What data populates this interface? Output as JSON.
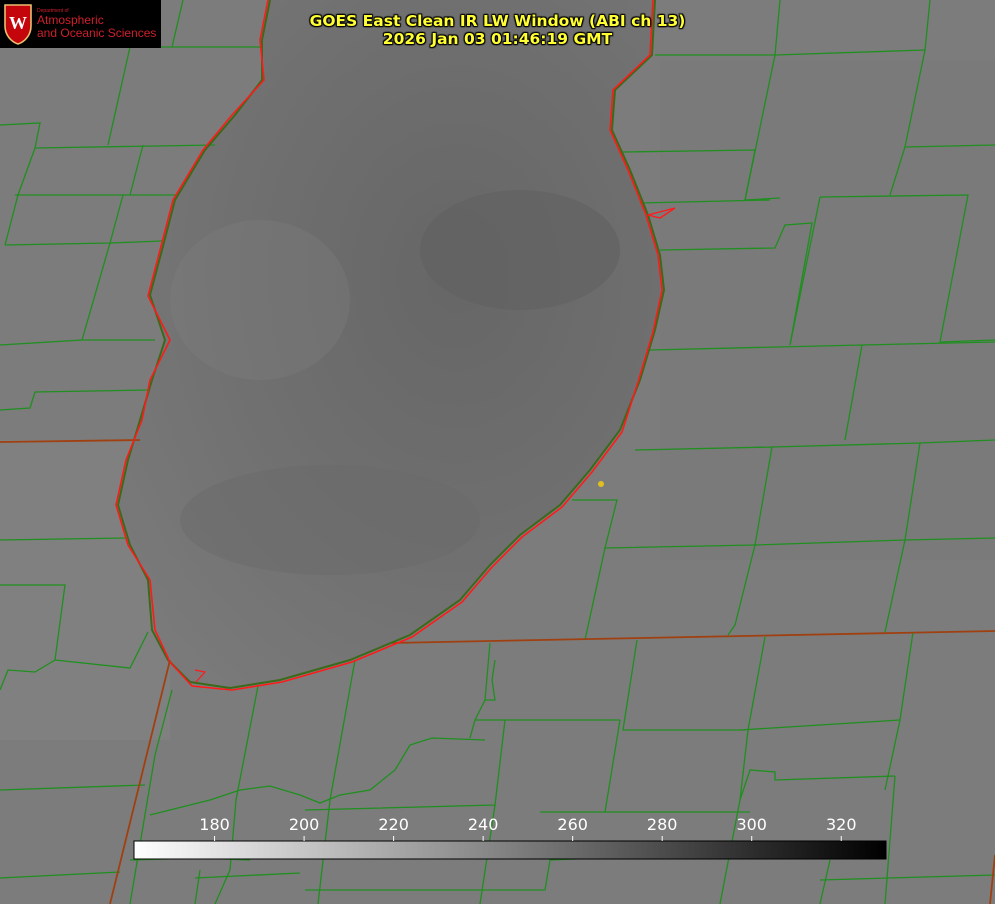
{
  "header": {
    "title_line1": "GOES East Clean IR LW Window (ABI ch 13)",
    "title_line2": "2026 Jan 03 01:46:19 GMT"
  },
  "logo": {
    "department": "Department of",
    "line1": "Atmospheric",
    "line2": "and Oceanic Sciences",
    "seal_letter": "W"
  },
  "colorbar": {
    "ticks": [
      "180",
      "200",
      "220",
      "240",
      "260",
      "280",
      "300",
      "320"
    ],
    "tick_values": [
      180,
      200,
      220,
      240,
      260,
      280,
      300,
      320
    ],
    "min": 162,
    "max": 330,
    "gradient": "white-to-black"
  },
  "colors": {
    "title": "#ffff33",
    "county_lines": "#1f8f1f",
    "state_lines": "#a04010",
    "coastline": "#ff1a1a",
    "marker": "#e0c020",
    "logo_text": "#d11f2c"
  }
}
